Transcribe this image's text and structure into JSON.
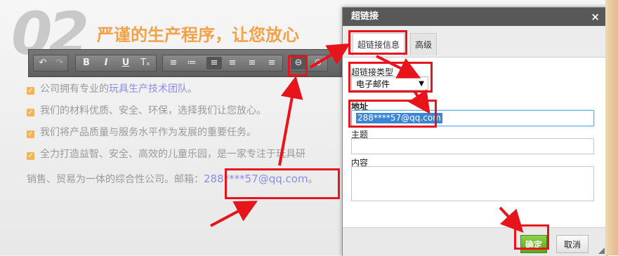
{
  "page": {
    "section_number": "02",
    "headline": "严谨的生产程序，让您放心",
    "bullets": [
      {
        "text": "公司拥有专业的",
        "link": "玩具生产技术团队",
        "tail": "。"
      },
      {
        "text": "我们的材料优质、安全、环保，选择我们让您放心。"
      },
      {
        "text": "我们将产品质量与服务水平作为发展的重要任务。"
      },
      {
        "text": "全力打造益智、安全、高效的儿童乐园，是一家专注于玩具研"
      }
    ],
    "last_line_prefix": "销售、贸易为一体的综合性公司。邮箱：",
    "email": "288****57@qq.com",
    "last_line_suffix": "。"
  },
  "toolbar": {
    "buttons": [
      "undo-icon",
      "redo-icon",
      "bold-icon",
      "italic-icon",
      "underline-icon",
      "clear-format-icon",
      "ordered-list-icon",
      "unordered-list-icon",
      "align-left-icon",
      "align-center-icon",
      "align-right-icon",
      "justify-icon",
      "link-icon",
      "unlink-icon"
    ],
    "glyphs": {
      "undo": "↶",
      "redo": "↷",
      "bold": "B",
      "italic": "I",
      "underline": "U",
      "clear": "Tₓ",
      "ol": "≡",
      "ul": "≔",
      "al": "≡",
      "ac": "≡",
      "ar": "≡",
      "aj": "≡",
      "link": "⊖",
      "unlink": "⊘"
    }
  },
  "dialog": {
    "title": "超链接",
    "close": "×",
    "tabs": [
      "超链接信息",
      "高级"
    ],
    "link_type_label": "超链接类型",
    "link_type_value": "电子邮件",
    "address_label": "地址",
    "address_value": "288****57@qq.com",
    "subject_label": "主题",
    "body_label": "内容",
    "ok": "确定",
    "cancel": "取消"
  },
  "colors": {
    "highlight": "#e8141b",
    "accent": "#f1a24a",
    "ok_green": "#5ba51f"
  }
}
